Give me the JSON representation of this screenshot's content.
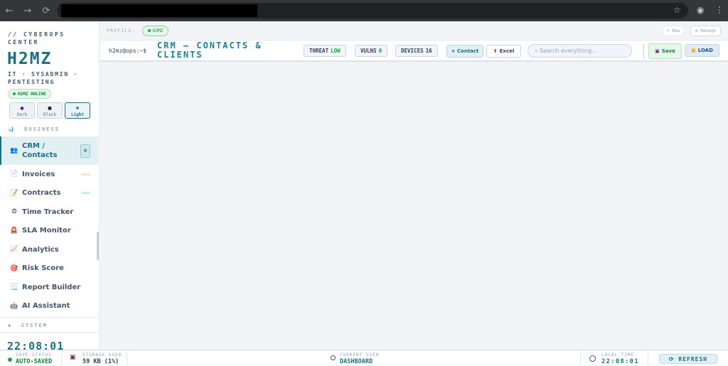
{
  "browser": {
    "back": "←",
    "forward": "→",
    "reload": "⟳",
    "star": "☆",
    "profile": "◉",
    "menu": "⋮"
  },
  "sidebar": {
    "brand_sub": "// CYBEROPS CENTER",
    "logo": "H2MZ",
    "tagline": "IT · SYSADMIN · PENTESTING",
    "online": "H2MZ ONLINE",
    "themes": [
      {
        "icon": "●",
        "label": "Dark"
      },
      {
        "icon": "■",
        "label": "Black"
      },
      {
        "icon": "✹",
        "label": "Light"
      }
    ],
    "section_business": "BUSINESS",
    "section_business_icon": "📊",
    "items": [
      {
        "icon": "👥",
        "label": "CRM / Contacts",
        "badge": "0"
      },
      {
        "icon": "📄",
        "label": "Invoices"
      },
      {
        "icon": "📝",
        "label": "Contracts"
      },
      {
        "icon": "⏱",
        "label": "Time Tracker"
      },
      {
        "icon": "🚨",
        "label": "SLA Monitor"
      },
      {
        "icon": "📈",
        "label": "Analytics"
      },
      {
        "icon": "🎯",
        "label": "Risk Score"
      },
      {
        "icon": "📃",
        "label": "Report Builder"
      },
      {
        "icon": "🤖",
        "label": "AI Assistant"
      }
    ],
    "section_system": "SYSTEM",
    "section_system_icon": "◆",
    "clock": "22:08:01"
  },
  "profile": {
    "label": "PROFILE:",
    "current": "H2MZ",
    "new": "+ New",
    "manage": "⚙ Manage"
  },
  "header": {
    "prompt": "h2mz@ops:~$",
    "title": "CRM — CONTACTS & CLIENTS",
    "threat_label": "THREAT",
    "threat_value": "LOW",
    "vulns_label": "VULNS",
    "vulns_value": "0",
    "devices_label": "DEVICES",
    "devices_value": "16",
    "add_contact": "+ Contact",
    "excel": "Excel",
    "search_placeholder": "⌕ Search everything...",
    "save": "Save",
    "load": "LOAD"
  },
  "footer": {
    "save_status_label": "SAVE STATUS",
    "save_status": "AUTO-SAVED",
    "storage_label": "STORAGE USED",
    "storage": "59 KB (1%)",
    "view_label": "CURRENT VIEW",
    "view": "DASHBOARD",
    "time_label": "LOCAL TIME",
    "time": "22:08:01",
    "refresh": "⟳ REFRESH"
  }
}
